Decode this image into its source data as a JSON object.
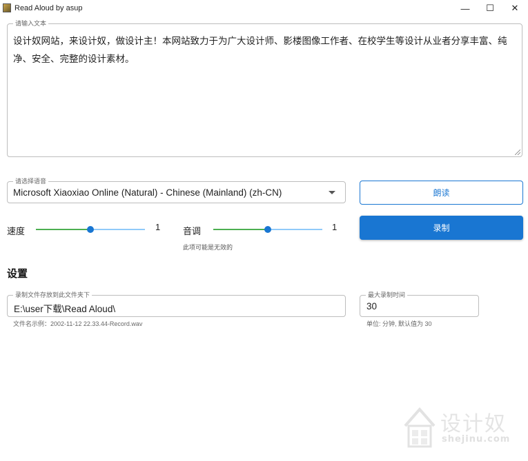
{
  "window": {
    "title": "Read Aloud by asup",
    "minimize_glyph": "—",
    "maximize_glyph": "☐",
    "close_glyph": "✕"
  },
  "input": {
    "legend": "请输入文本",
    "text": "设计奴网站，来设计奴，做设计主！本网站致力于为广大设计师、影楼图像工作者、在校学生等设计从业者分享丰富、纯净、安全、完整的设计素材。"
  },
  "voice": {
    "legend": "请选择语音",
    "selected": "Microsoft Xiaoxiao Online (Natural) - Chinese (Mainland) (zh-CN)"
  },
  "buttons": {
    "read": "朗读",
    "record": "录制"
  },
  "speed": {
    "label": "速度",
    "value_text": "1",
    "fraction": 0.5
  },
  "pitch": {
    "label": "音调",
    "value_text": "1",
    "fraction": 0.5,
    "hint": "此项可能是无效的"
  },
  "settings": {
    "title": "设置",
    "folder": {
      "legend": "录制文件存放到此文件夹下",
      "value": "E:\\user下载\\Read Aloud\\",
      "helper": "文件名示例：2002-11-12 22.33.44-Record.wav"
    },
    "max_time": {
      "legend": "最大录制时间",
      "value": "30",
      "helper": "单位: 分钟, 默认值为 30"
    }
  },
  "watermark": {
    "text": "设计奴",
    "sub": "shejinu.com"
  },
  "colors": {
    "accent": "#1976d2",
    "slider_fill": "#4caf50",
    "slider_rest": "#90caf9"
  }
}
